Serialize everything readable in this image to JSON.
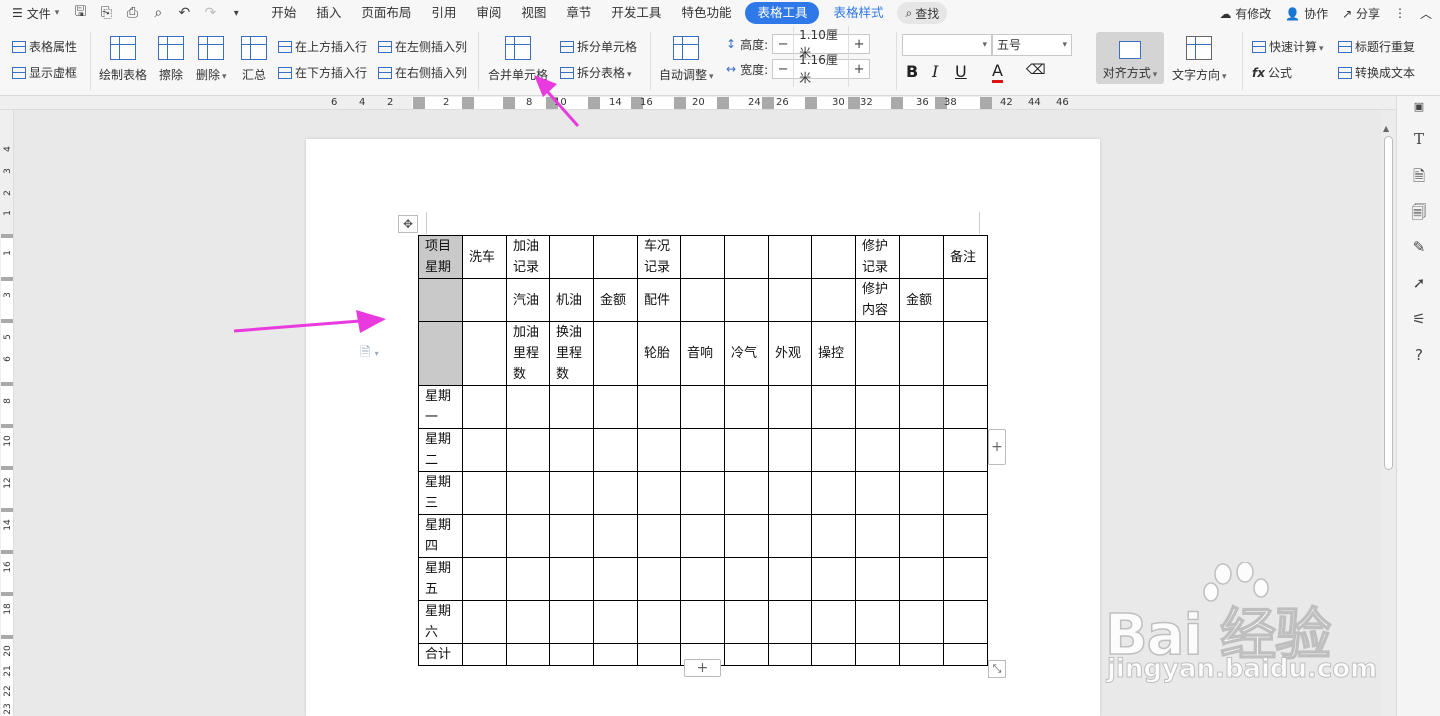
{
  "menubar": {
    "file_label": "文件",
    "tabs": [
      "开始",
      "插入",
      "页面布局",
      "引用",
      "审阅",
      "视图",
      "章节",
      "开发工具",
      "特色功能"
    ],
    "active_tab": "表格工具",
    "extra_tab": "表格样式",
    "search_label": "查找",
    "right": {
      "modified": "有修改",
      "collab": "协作",
      "share": "分享"
    }
  },
  "ribbon": {
    "table_props": "表格属性",
    "show_gridlines": "显示虚框",
    "draw_table": "绘制表格",
    "erase": "擦除",
    "delete": "删除",
    "summary": "汇总",
    "insert_above": "在上方插入行",
    "insert_below": "在下方插入行",
    "insert_left": "在左侧插入列",
    "insert_right": "在右侧插入列",
    "merge_cells": "合并单元格",
    "split_cells": "拆分单元格",
    "split_table": "拆分表格",
    "auto_fit": "自动调整",
    "height_label": "高度:",
    "height_value": "1.10厘米",
    "width_label": "宽度:",
    "width_value": "1.16厘米",
    "font_size": "五号",
    "align": "对齐方式",
    "text_direction": "文字方向",
    "quick_calc": "快速计算",
    "formula": "公式",
    "repeat_header": "标题行重复",
    "to_text": "转换成文本"
  },
  "ruler": {
    "h_left": [
      "6",
      "4",
      "2"
    ],
    "h_right": [
      "2",
      "8",
      "10",
      "14",
      "16",
      "20",
      "24",
      "26",
      "30",
      "32",
      "36",
      "38",
      "42",
      "44",
      "46"
    ],
    "v": [
      "4",
      "3",
      "2",
      "1",
      "1",
      "3",
      "5",
      "6",
      "8",
      "10",
      "12",
      "14",
      "16",
      "18",
      "20",
      "21",
      "22",
      "23"
    ]
  },
  "table": {
    "rows": [
      [
        "项目星期",
        "洗车",
        "加油记录",
        "",
        "",
        "车况记录",
        "",
        "",
        "",
        "",
        "修护记录",
        "",
        "备注"
      ],
      [
        "",
        "",
        "汽油",
        "机油",
        "金额",
        "配件",
        "",
        "",
        "",
        "",
        "修护内容",
        "金额",
        ""
      ],
      [
        "",
        "",
        "加油里程数",
        "换油里程数",
        "",
        "轮胎",
        "音响",
        "冷气",
        "外观",
        "操控",
        "",
        "",
        ""
      ],
      [
        "星期一",
        "",
        "",
        "",
        "",
        "",
        "",
        "",
        "",
        "",
        "",
        "",
        ""
      ],
      [
        "星期二",
        "",
        "",
        "",
        "",
        "",
        "",
        "",
        "",
        "",
        "",
        "",
        ""
      ],
      [
        "星期三",
        "",
        "",
        "",
        "",
        "",
        "",
        "",
        "",
        "",
        "",
        "",
        ""
      ],
      [
        "星期四",
        "",
        "",
        "",
        "",
        "",
        "",
        "",
        "",
        "",
        "",
        "",
        ""
      ],
      [
        "星期五",
        "",
        "",
        "",
        "",
        "",
        "",
        "",
        "",
        "",
        "",
        "",
        ""
      ],
      [
        "星期六",
        "",
        "",
        "",
        "",
        "",
        "",
        "",
        "",
        "",
        "",
        "",
        ""
      ],
      [
        "合计",
        "",
        "",
        "",
        "",
        "",
        "",
        "",
        "",
        "",
        "",
        "",
        ""
      ]
    ]
  },
  "watermark": {
    "brand": "Bai  经验",
    "url": "jingyan.baidu.com"
  },
  "colors": {
    "accent": "#2f78e8",
    "arrow": "#e83adf",
    "selection": "#c9c9c9"
  }
}
